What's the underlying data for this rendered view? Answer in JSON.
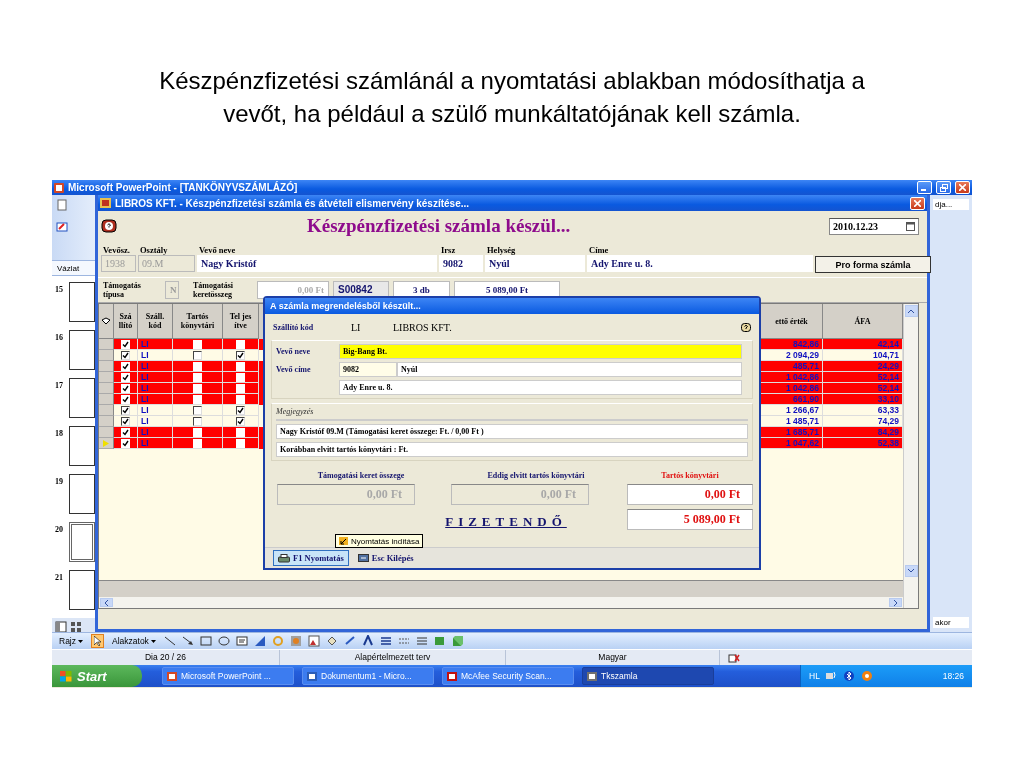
{
  "slide_title": "Készpénzfizetési számlánál a nyomtatási ablakban módosíthatja a vevőt, ha például a szülő munkáltatójának kell számla.",
  "powerpoint": {
    "title": "Microsoft PowerPoint - [TANKÖNYVSZÁMLÁZÓ]",
    "outline_tab": "Vázlat",
    "thumbnails": [
      {
        "number": "15",
        "selected": false
      },
      {
        "number": "16",
        "selected": false
      },
      {
        "number": "17",
        "selected": false
      },
      {
        "number": "18",
        "selected": false
      },
      {
        "number": "19",
        "selected": false
      },
      {
        "number": "20",
        "selected": true
      },
      {
        "number": "21",
        "selected": false
      }
    ],
    "task_pane_texts": [
      "dja...",
      "akor"
    ]
  },
  "app_window": {
    "title": "LIBROS KFT. - Készpénzfizetési számla és átvételi elismervény készítése...",
    "heading": "Készpénzfizetési számla készül...",
    "date": "2010.12.23",
    "customer_fields": [
      {
        "label": "Vevősz.",
        "value": "1938",
        "disabled": true
      },
      {
        "label": "Osztály",
        "value": "09.M",
        "disabled": true
      },
      {
        "label": "Vevő neve",
        "value": "Nagy Kristóf",
        "disabled": false
      },
      {
        "label": "Irsz",
        "value": "9082",
        "disabled": false
      },
      {
        "label": "Helység",
        "value": "Nyúl",
        "disabled": false
      },
      {
        "label": "Címe",
        "value": "Ady Enre u. 8.",
        "disabled": false
      }
    ],
    "pro_forma_button": "Pro forma számla",
    "support": {
      "type_label": "Támogatás típusa",
      "type_value": "N",
      "amount_label": "Támogatási keretösszeg",
      "amount_value": "0,00 Ft",
      "invoice_number": "S00842",
      "quantity": "3 db",
      "total": "5 089,00 Ft"
    },
    "grid": {
      "columns": [
        "Szá llító",
        "Száll. kód",
        "Tartós könyvtári",
        "Tel jes ítve",
        "ettő érték",
        "ÁFA"
      ],
      "rows": [
        {
          "selected": false,
          "highlighted": true,
          "supplier_checked": true,
          "code": "LI",
          "durable": false,
          "completed": false,
          "net": "842,86",
          "vat": "42,14"
        },
        {
          "selected": false,
          "highlighted": false,
          "supplier_checked": true,
          "code": "LI",
          "durable": false,
          "completed": true,
          "net": "2 094,29",
          "vat": "104,71"
        },
        {
          "selected": false,
          "highlighted": true,
          "supplier_checked": true,
          "code": "LI",
          "durable": false,
          "completed": false,
          "net": "485,71",
          "vat": "24,29"
        },
        {
          "selected": false,
          "highlighted": true,
          "supplier_checked": true,
          "code": "LI",
          "durable": false,
          "completed": false,
          "net": "1 042,86",
          "vat": "52,14"
        },
        {
          "selected": false,
          "highlighted": true,
          "supplier_checked": true,
          "code": "LI",
          "durable": false,
          "completed": false,
          "net": "1 042,86",
          "vat": "52,14"
        },
        {
          "selected": false,
          "highlighted": true,
          "supplier_checked": true,
          "code": "LI",
          "durable": false,
          "completed": false,
          "net": "661,90",
          "vat": "33,10"
        },
        {
          "selected": false,
          "highlighted": false,
          "supplier_checked": true,
          "code": "LI",
          "durable": false,
          "completed": true,
          "net": "1 266,67",
          "vat": "63,33"
        },
        {
          "selected": false,
          "highlighted": false,
          "supplier_checked": true,
          "code": "LI",
          "durable": false,
          "completed": true,
          "net": "1 485,71",
          "vat": "74,29"
        },
        {
          "selected": false,
          "highlighted": true,
          "supplier_checked": true,
          "code": "LI",
          "durable": false,
          "completed": false,
          "net": "1 685,71",
          "vat": "84,29"
        },
        {
          "selected": true,
          "highlighted": true,
          "supplier_checked": true,
          "code": "LI",
          "durable": false,
          "completed": false,
          "net": "1 047,62",
          "vat": "52,38"
        }
      ]
    }
  },
  "dialog": {
    "title": "A számla megrendelésből készült...",
    "supplier_label": "Szállító kód",
    "supplier_code": "LI",
    "supplier_name": "LIBROS KFT.",
    "buyer_name_label": "Vevő neve",
    "buyer_name": "Big-Bang Bt.",
    "buyer_address_label": "Vevő címe",
    "buyer_zip": "9082",
    "buyer_city": "Nyúl",
    "buyer_street": "Ady Enre u. 8.",
    "note_label": "Megjegyzés",
    "note_lines": [
      "Nagy Kristóf 09.M (Támogatási keret összege: Ft. / 0,00 Ft )",
      "Korábban elvitt tartós könyvtári : Ft."
    ],
    "totals": [
      {
        "label": "Támogatási keret összege",
        "value": "0,00 Ft",
        "disabled": true
      },
      {
        "label": "Eddig elvitt tartós könyvtári",
        "value": "0,00 Ft",
        "disabled": true
      },
      {
        "label": "Tartós könyvtári",
        "value": "0,00 Ft",
        "disabled": false
      }
    ],
    "payable_label": "FIZETENDŐ",
    "payable": "5 089,00 Ft",
    "buttons": [
      {
        "label": "F1 Nyomtatás",
        "selected": true
      },
      {
        "label": "Esc Kilépés",
        "selected": false
      }
    ],
    "tooltip": "Nyomtatás indítása"
  },
  "drawing_toolbar": {
    "draw_menu": "Rajz",
    "shapes_menu": "Alakzatok"
  },
  "status_bar": [
    "Dia 20 / 26",
    "Alapértelmezett terv",
    "Magyar"
  ],
  "taskbar": {
    "start": "Start",
    "buttons": [
      {
        "label": "Microsoft PowerPoint ...",
        "selected": false
      },
      {
        "label": "Dokumentum1 - Micro...",
        "selected": false
      },
      {
        "label": "McAfee Security Scan...",
        "selected": false
      },
      {
        "label": "Tkszamla",
        "selected": true
      }
    ],
    "language": "HL",
    "clock": "18:26"
  }
}
